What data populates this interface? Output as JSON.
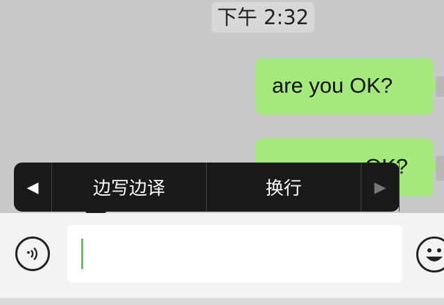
{
  "chat": {
    "timestamp": "下午 2:32",
    "messages": [
      {
        "text": "are you OK?",
        "sender": "me"
      },
      {
        "text": "OK?",
        "sender": "me"
      }
    ]
  },
  "context_menu": {
    "prev_arrow": "◀",
    "items": [
      {
        "label": "边写边译"
      },
      {
        "label": "换行"
      }
    ],
    "next_arrow": "▶"
  },
  "input_bar": {
    "voice_icon": "voice-icon",
    "emoji_icon": "emoji-icon",
    "input_value": ""
  },
  "colors": {
    "bubble_outgoing": "#a5e97c",
    "caret": "#5fbf66",
    "menu_bg": "#1a1a1a"
  }
}
